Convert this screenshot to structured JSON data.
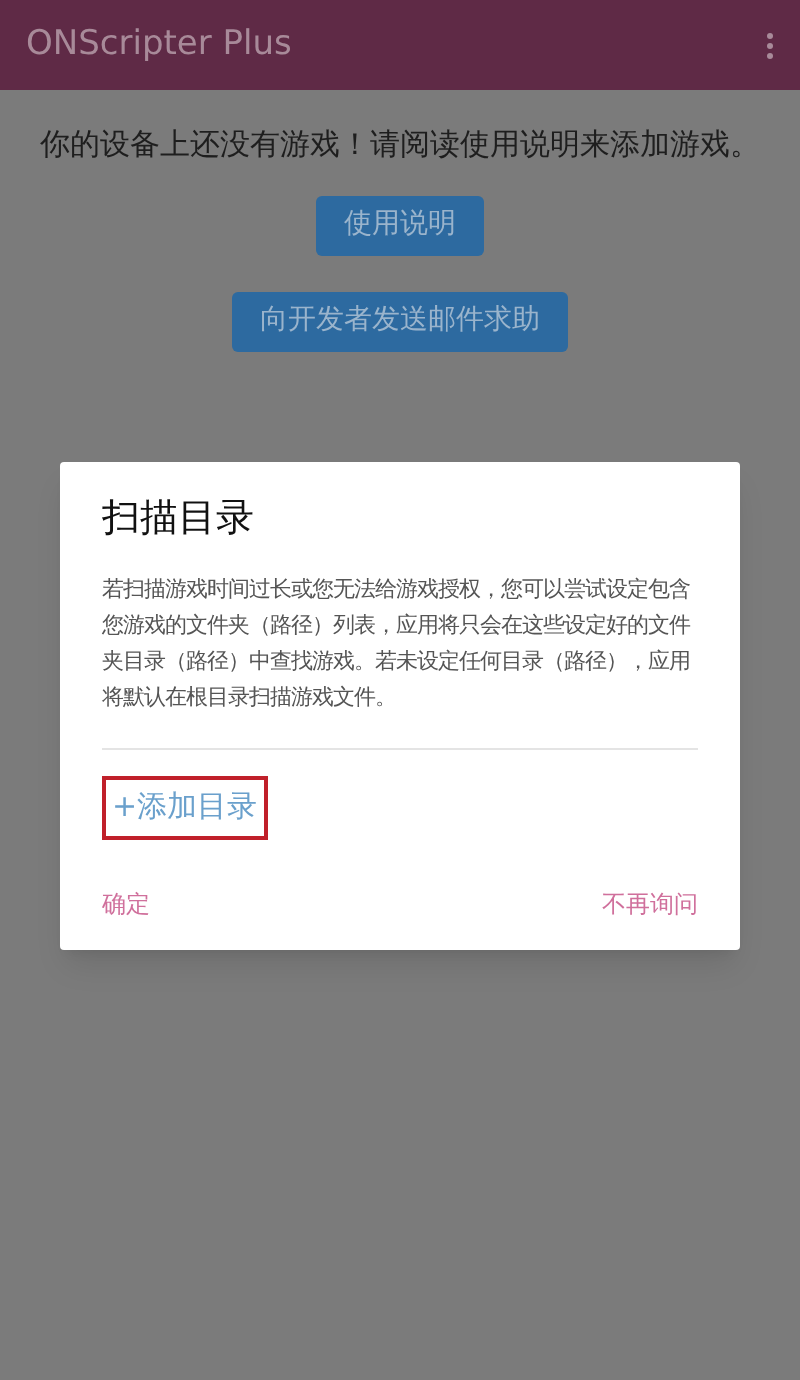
{
  "app_bar": {
    "title": "ONScripter Plus"
  },
  "page": {
    "message": "你的设备上还没有游戏！请阅读使用说明来添加游戏。",
    "buttons": [
      "使用说明",
      "向开发者发送邮件求助"
    ]
  },
  "dialog": {
    "title": "扫描目录",
    "body": "若扫描游戏时间过长或您无法给游戏授权，您可以尝试设定包含您游戏的文件夹（路径）列表，应用将只会在这些设定好的文件夹目录（路径）中查找游戏。若未设定任何目录（路径），应用将默认在根目录扫描游戏文件。",
    "add_link": {
      "label": "+添加目录",
      "highlighted": true
    },
    "actions": [
      "确定",
      "不再询问"
    ]
  }
}
